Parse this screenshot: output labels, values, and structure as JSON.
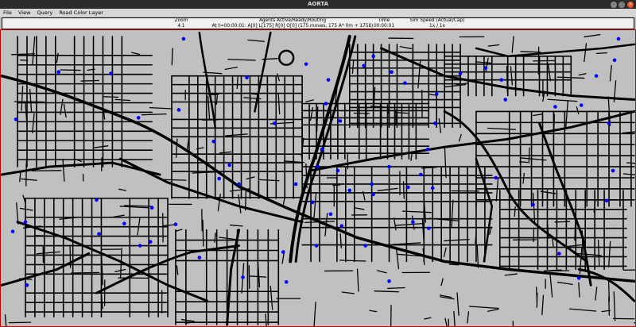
{
  "window": {
    "title": "AORTA",
    "min_icon": "minimize-icon",
    "max_icon": "maximize-icon",
    "close_icon": "close-icon"
  },
  "menu": {
    "items": [
      "File",
      "View",
      "Query",
      "Road Color Layer"
    ]
  },
  "status": {
    "zoom_label": "Zoom",
    "zoom_value": "4.1",
    "agents_label": "Agents Active/Ready/Routing",
    "agents_value": "At t=00:00:01: A[0] L[175] R[0] O[0] (175 moves, 175 A* 0m + 175ß)",
    "time_label": "Time",
    "time_value": "00:00:01",
    "speed_label": "Sim Speed (Actual/Cap)",
    "speed_value": "1x / 1x"
  },
  "colors": {
    "road": "#000000",
    "agent": "#0000ff",
    "background": "#c0c0c0",
    "border": "#cc0000"
  }
}
